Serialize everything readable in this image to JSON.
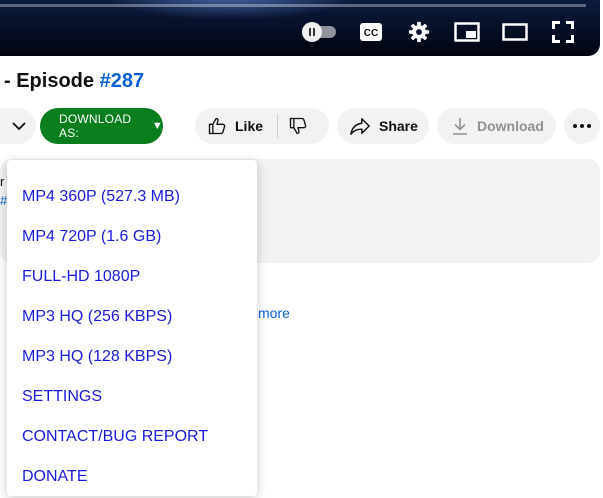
{
  "title": {
    "prefix": "- Episode ",
    "hash": "#287"
  },
  "actions": {
    "download_as_label": "DOWNLOAD AS:",
    "download_as_arrow": "▼",
    "like_label": "Like",
    "share_label": "Share",
    "download_label": "Download"
  },
  "description": {
    "fragment_1": "r",
    "fragment_2": "#",
    "more_label": "more"
  },
  "menu": {
    "items": [
      "MP4 360P (527.3 MB)",
      "MP4 720P (1.6 GB)",
      "FULL-HD 1080P",
      "MP3 HQ (256 KBPS)",
      "MP3 HQ (128 KBPS)",
      "SETTINGS",
      "CONTACT/BUG REPORT",
      "DONATE"
    ]
  },
  "colors": {
    "download_as_bg": "#0a7d1c",
    "link_blue": "#065fd4",
    "menu_text": "#1a1adb"
  },
  "icons": [
    "autoplay-toggle-icon",
    "captions-icon",
    "settings-gear-icon",
    "miniplayer-icon",
    "theater-mode-icon",
    "fullscreen-icon",
    "chevron-down-icon",
    "thumbs-up-icon",
    "thumbs-down-icon",
    "share-arrow-icon",
    "download-icon",
    "more-dots-icon"
  ]
}
